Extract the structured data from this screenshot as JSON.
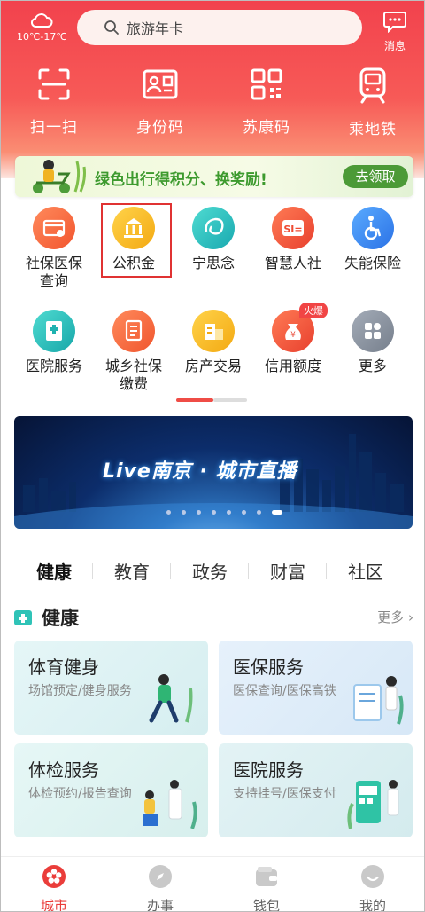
{
  "weather": {
    "temp": "10℃-17℃",
    "icon": "cloud-icon"
  },
  "search": {
    "placeholder": "旅游年卡"
  },
  "message": {
    "label": "消息"
  },
  "quick_actions": [
    {
      "label": "扫一扫",
      "icon": "scan-icon"
    },
    {
      "label": "身份码",
      "icon": "id-card-icon"
    },
    {
      "label": "苏康码",
      "icon": "qr-code-icon"
    },
    {
      "label": "乘地铁",
      "icon": "metro-icon"
    }
  ],
  "promo": {
    "text": "绿色出行得积分、换奖励!",
    "button": "去领取"
  },
  "services": [
    {
      "label": "社保医保查询",
      "color": "#f4663d"
    },
    {
      "label": "公积金",
      "color": "#f5b619"
    },
    {
      "label": "宁思念",
      "color": "#2cc5c0"
    },
    {
      "label": "智慧人社",
      "color": "#f25a3e"
    },
    {
      "label": "失能保险",
      "color": "#3b8ef2"
    },
    {
      "label": "医院服务",
      "color": "#27c1bf"
    },
    {
      "label": "城乡社保缴费",
      "color": "#f6703e"
    },
    {
      "label": "房产交易",
      "color": "#f7b823"
    },
    {
      "label": "信用额度",
      "color": "#f3533a",
      "badge": "火爆"
    },
    {
      "label": "更多",
      "color": "#8b95a3"
    }
  ],
  "hero": {
    "text": "Live南京 · 城市直播"
  },
  "tabs": [
    "健康",
    "教育",
    "政务",
    "财富",
    "社区"
  ],
  "section": {
    "title": "健康",
    "more": "更多"
  },
  "cards": [
    {
      "title": "体育健身",
      "subtitle": "场馆预定/健身服务"
    },
    {
      "title": "医保服务",
      "subtitle": "医保查询/医保高铁"
    },
    {
      "title": "体检服务",
      "subtitle": "体检预约/报告查询"
    },
    {
      "title": "医院服务",
      "subtitle": "支持挂号/医保支付"
    }
  ],
  "bottom_nav": [
    {
      "label": "城市",
      "active": true
    },
    {
      "label": "办事",
      "active": false
    },
    {
      "label": "钱包",
      "active": false
    },
    {
      "label": "我的",
      "active": false
    }
  ]
}
